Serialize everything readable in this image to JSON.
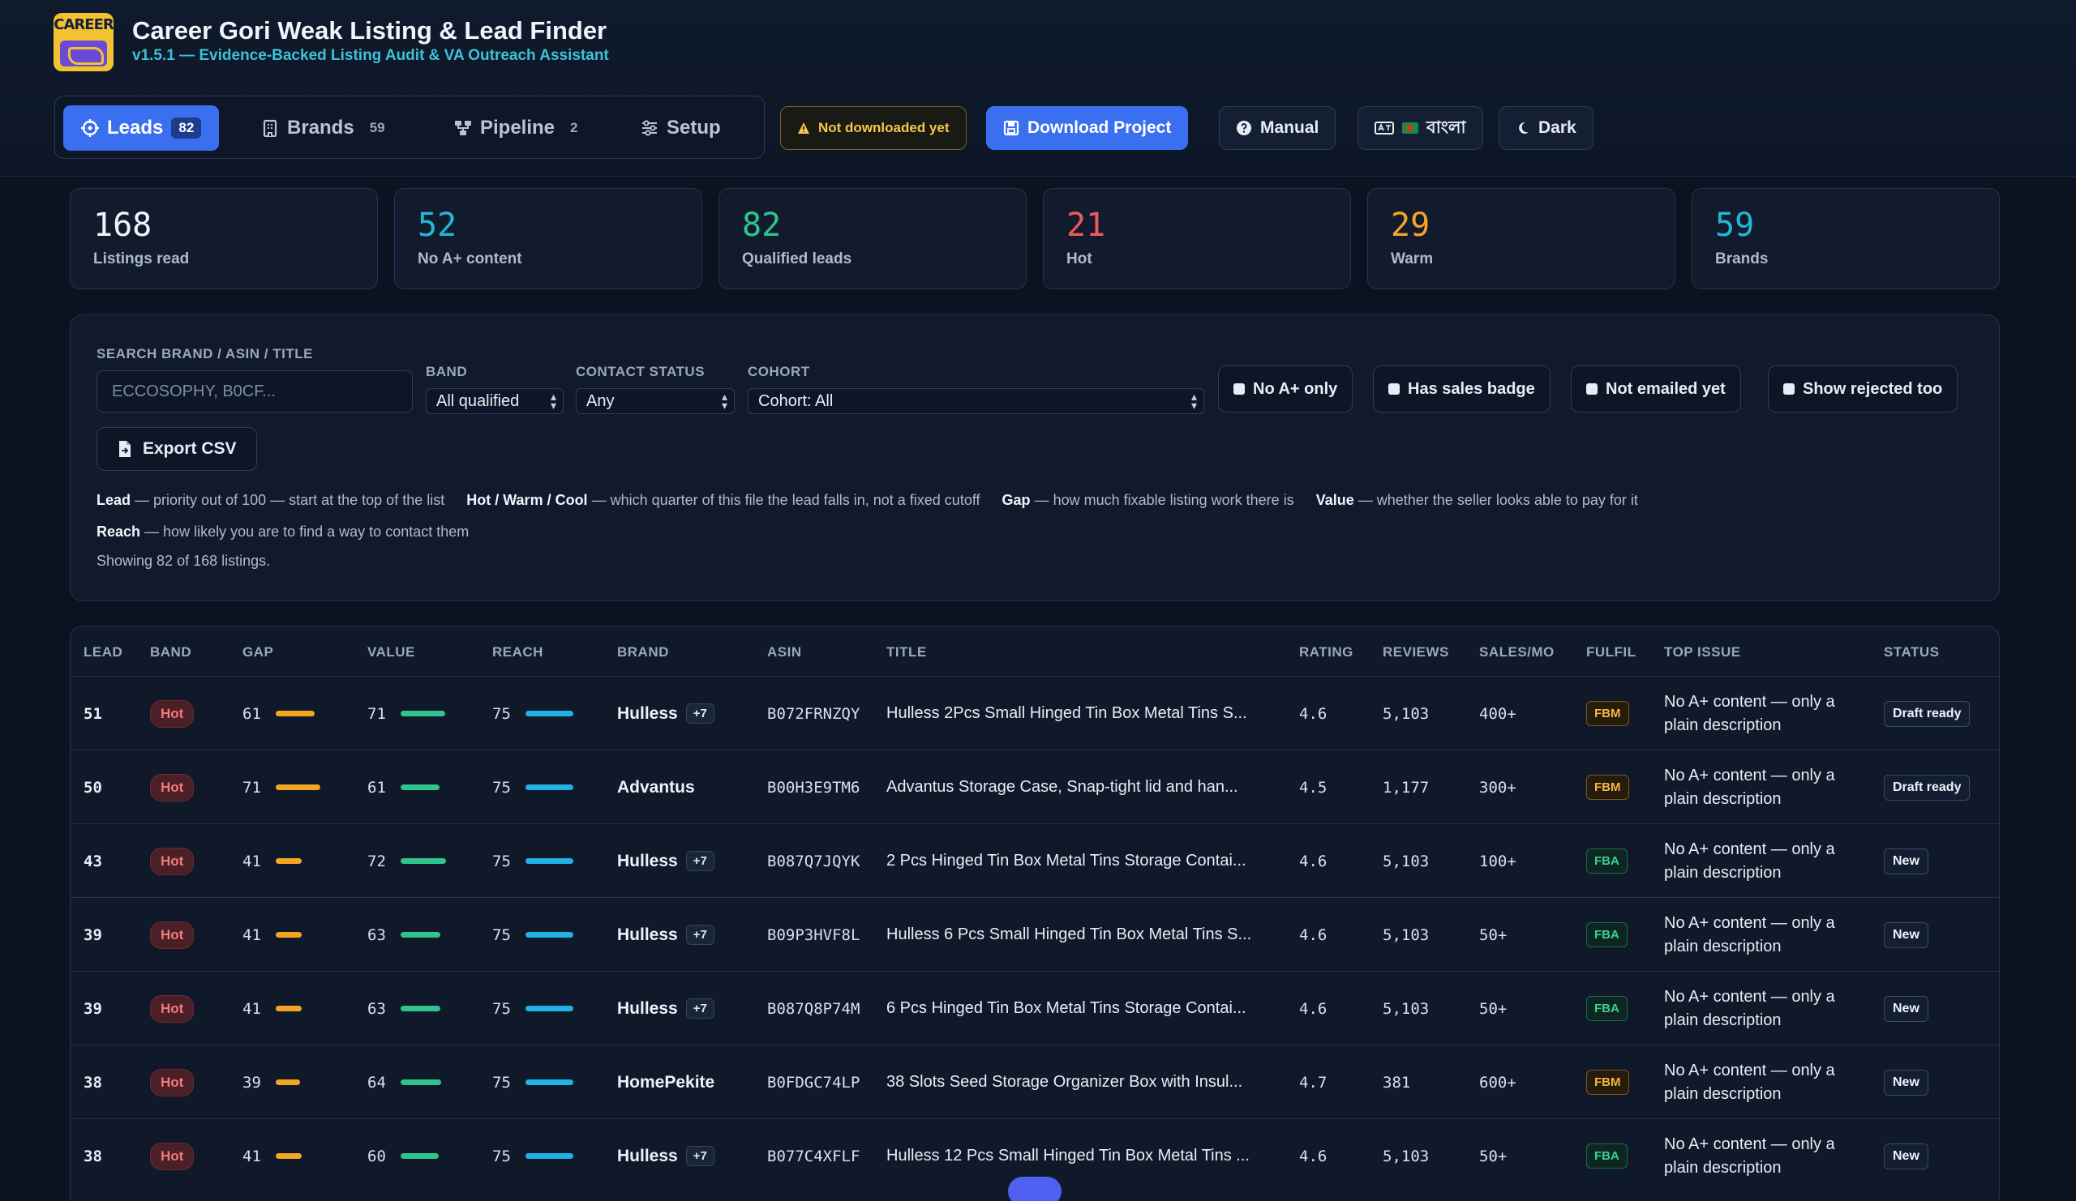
{
  "app": {
    "logo_text": "CAREER",
    "title": "Career Gori Weak Listing & Lead Finder",
    "subtitle": "v1.5.1 — Evidence-Backed Listing Audit & VA Outreach Assistant"
  },
  "tabs": [
    {
      "label": "Leads",
      "count": "82",
      "active": true
    },
    {
      "label": "Brands",
      "count": "59"
    },
    {
      "label": "Pipeline",
      "count": "2"
    },
    {
      "label": "Setup",
      "count": ""
    }
  ],
  "header_buttons": {
    "not_downloaded": "Not downloaded yet",
    "download": "Download Project",
    "manual": "Manual",
    "language": "বাংলা",
    "theme": "Dark"
  },
  "stats": [
    {
      "value": "168",
      "label": "Listings read",
      "color": "#f1f5fb"
    },
    {
      "value": "52",
      "label": "No A+ content",
      "color": "#22b8d6"
    },
    {
      "value": "82",
      "label": "Qualified leads",
      "color": "#2fc48d"
    },
    {
      "value": "21",
      "label": "Hot",
      "color": "#ef5a5f"
    },
    {
      "value": "29",
      "label": "Warm",
      "color": "#f5a524"
    },
    {
      "value": "59",
      "label": "Brands",
      "color": "#22b8d6"
    }
  ],
  "filters": {
    "search_label": "SEARCH BRAND / ASIN / TITLE",
    "search_placeholder": "ECCOSOPHY, B0CF...",
    "band_label": "BAND",
    "band_value": "All qualified",
    "contact_label": "CONTACT STATUS",
    "contact_value": "Any",
    "cohort_label": "COHORT",
    "cohort_value": "Cohort: All",
    "checkboxes": [
      "No A+ only",
      "Has sales badge",
      "Not emailed yet",
      "Show rejected too"
    ],
    "export_label": "Export CSV",
    "legend": [
      {
        "term": "Lead",
        "desc": "— priority out of 100 — start at the top of the list"
      },
      {
        "term": "Hot / Warm / Cool",
        "desc": "— which quarter of this file the lead falls in, not a fixed cutoff"
      },
      {
        "term": "Gap",
        "desc": "— how much fixable listing work there is"
      },
      {
        "term": "Value",
        "desc": "— whether the seller looks able to pay for it"
      },
      {
        "term": "Reach",
        "desc": "— how likely you are to find a way to contact them"
      }
    ],
    "showing": "Showing 82 of 168 listings."
  },
  "table": {
    "headers": [
      "LEAD",
      "BAND",
      "GAP",
      "VALUE",
      "REACH",
      "BRAND",
      "ASIN",
      "TITLE",
      "RATING",
      "REVIEWS",
      "SALES/MO",
      "FULFIL",
      "TOP ISSUE",
      "STATUS"
    ],
    "rows": [
      {
        "lead": "51",
        "band": "Hot",
        "gap": 61,
        "value": 71,
        "reach": 75,
        "brand": "Hulless",
        "plus": "+7",
        "asin": "B072FRNZQY",
        "title": "Hulless 2Pcs Small Hinged Tin Box Metal Tins S...",
        "rating": "4.6",
        "reviews": "5,103",
        "sales": "400+",
        "fulfil": "FBM",
        "issue": "No A+ content — only a plain description",
        "status": "Draft ready"
      },
      {
        "lead": "50",
        "band": "Hot",
        "gap": 71,
        "value": 61,
        "reach": 75,
        "brand": "Advantus",
        "plus": "",
        "asin": "B00H3E9TM6",
        "title": "Advantus Storage Case, Snap-tight lid and han...",
        "rating": "4.5",
        "reviews": "1,177",
        "sales": "300+",
        "fulfil": "FBM",
        "issue": "No A+ content — only a plain description",
        "status": "Draft ready"
      },
      {
        "lead": "43",
        "band": "Hot",
        "gap": 41,
        "value": 72,
        "reach": 75,
        "brand": "Hulless",
        "plus": "+7",
        "asin": "B087Q7JQYK",
        "title": "2 Pcs Hinged Tin Box Metal Tins Storage Contai...",
        "rating": "4.6",
        "reviews": "5,103",
        "sales": "100+",
        "fulfil": "FBA",
        "issue": "No A+ content — only a plain description",
        "status": "New"
      },
      {
        "lead": "39",
        "band": "Hot",
        "gap": 41,
        "value": 63,
        "reach": 75,
        "brand": "Hulless",
        "plus": "+7",
        "asin": "B09P3HVF8L",
        "title": "Hulless 6 Pcs Small Hinged Tin Box Metal Tins S...",
        "rating": "4.6",
        "reviews": "5,103",
        "sales": "50+",
        "fulfil": "FBA",
        "issue": "No A+ content — only a plain description",
        "status": "New"
      },
      {
        "lead": "39",
        "band": "Hot",
        "gap": 41,
        "value": 63,
        "reach": 75,
        "brand": "Hulless",
        "plus": "+7",
        "asin": "B087Q8P74M",
        "title": "6 Pcs Hinged Tin Box Metal Tins Storage Contai...",
        "rating": "4.6",
        "reviews": "5,103",
        "sales": "50+",
        "fulfil": "FBA",
        "issue": "No A+ content — only a plain description",
        "status": "New"
      },
      {
        "lead": "38",
        "band": "Hot",
        "gap": 39,
        "value": 64,
        "reach": 75,
        "brand": "HomePekite",
        "plus": "",
        "asin": "B0FDGC74LP",
        "title": "38 Slots Seed Storage Organizer Box with Insul...",
        "rating": "4.7",
        "reviews": "381",
        "sales": "600+",
        "fulfil": "FBM",
        "issue": "No A+ content — only a plain description",
        "status": "New"
      },
      {
        "lead": "38",
        "band": "Hot",
        "gap": 41,
        "value": 60,
        "reach": 75,
        "brand": "Hulless",
        "plus": "+7",
        "asin": "B077C4XFLF",
        "title": "Hulless 12 Pcs Small Hinged Tin Box Metal Tins ...",
        "rating": "4.6",
        "reviews": "5,103",
        "sales": "50+",
        "fulfil": "FBA",
        "issue": "No A+ content — only a plain description",
        "status": "New"
      }
    ]
  }
}
